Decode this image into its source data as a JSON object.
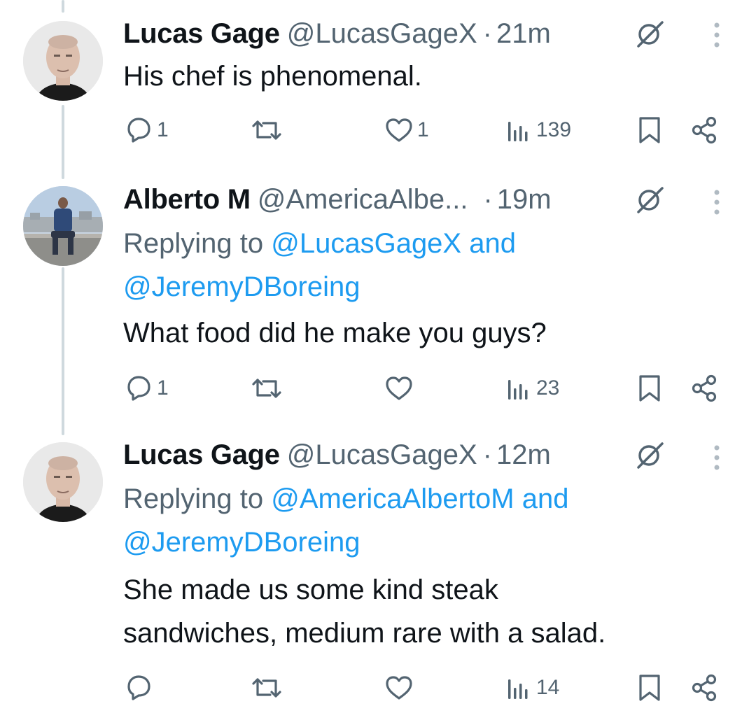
{
  "tweets": [
    {
      "name": "Lucas Gage",
      "handle": "@LucasGageX",
      "dot": "·",
      "time": "21m",
      "reply_to": null,
      "text_lines": [
        "His chef is phenomenal."
      ],
      "stats": {
        "replies": "1",
        "reposts": "",
        "likes": "1",
        "views": "139"
      }
    },
    {
      "name": "Alberto M",
      "handle": "@AmericaAlbe...",
      "dot": "·",
      "time": "19m",
      "reply_to": {
        "prefix": "Replying to ",
        "first": "@LucasGageX",
        "and": " and",
        "second": "@JeremyDBoreing"
      },
      "text_lines": [
        "What food did he make you guys?"
      ],
      "stats": {
        "replies": "1",
        "reposts": "",
        "likes": "",
        "views": "23"
      }
    },
    {
      "name": "Lucas Gage",
      "handle": "@LucasGageX",
      "dot": "·",
      "time": "12m",
      "reply_to": {
        "prefix": "Replying to ",
        "first": "@AmericaAlbertoM",
        "and": " and",
        "second": "@JeremyDBoreing"
      },
      "text_lines": [
        "She made us some kind steak",
        "sandwiches, medium rare with a salad."
      ],
      "stats": {
        "replies": "",
        "reposts": "",
        "likes": "",
        "views": "14"
      }
    }
  ],
  "icons": [
    "reply-icon",
    "repost-icon",
    "like-icon",
    "views-icon",
    "bookmark-icon",
    "share-icon",
    "grok-icon",
    "more-icon"
  ],
  "colors": {
    "text": "#0f1419",
    "muted": "#536471",
    "link": "#1d9bf0",
    "thread_line": "#cfd9de"
  }
}
